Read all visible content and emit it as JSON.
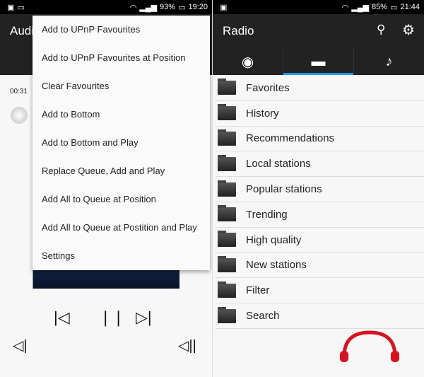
{
  "left": {
    "status": {
      "battery": "93%",
      "time": "19:20"
    },
    "title": "Audi",
    "elapsed": "00:31",
    "menu": [
      "Add to UPnP Favourites",
      "Add to UPnP Favourites at Position",
      "Clear Favourites",
      "Add to Bottom",
      "Add to Bottom and Play",
      "Replace Queue, Add and Play",
      "Add All to Queue at Position",
      "Add All to Queue at Postition and Play",
      "Settings"
    ],
    "controls": [
      "previous-icon",
      "pause-icon",
      "next-icon",
      "volume-down-icon",
      "volume-up-icon"
    ]
  },
  "right": {
    "status": {
      "battery": "85%",
      "time": "21:44"
    },
    "title": "Radio",
    "tabs": [
      "radio-icon",
      "inbox-icon",
      "music-note-icon"
    ],
    "selected_tab": 1,
    "accent": "#2196f3",
    "items": [
      "Favorites",
      "History",
      "Recommendations",
      "Local stations",
      "Popular stations",
      "Trending",
      "High quality",
      "New stations",
      "Filter",
      "Search"
    ]
  }
}
